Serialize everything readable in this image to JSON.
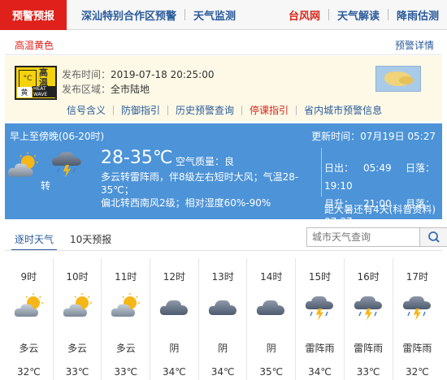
{
  "topnav": {
    "active": "预警预报",
    "items": [
      "深汕特别合作区预警",
      "天气监测"
    ],
    "right": [
      {
        "label": "台风网",
        "color": "red"
      },
      {
        "label": "天气解读",
        "color": "blue"
      },
      {
        "label": "降雨估测",
        "color": "blue"
      }
    ]
  },
  "warning": {
    "title": "高温黄色",
    "detail_link": "预警详情",
    "icon": {
      "name": "high-temperature-yellow-warning-icon",
      "glyph": "高温",
      "level": "黄",
      "sub": "HEAT WAVE",
      "therm": "°C"
    },
    "publish_time_label": "发布时间：",
    "publish_time": "2019-07-18 20:25:00",
    "area_label": "发布区域：",
    "area": "全市陆地",
    "links": [
      {
        "label": "信号含义",
        "color": "blue"
      },
      {
        "label": "防御指引",
        "color": "blue"
      },
      {
        "label": "历史预警查询",
        "color": "blue"
      },
      {
        "label": "停课指引",
        "color": "red"
      },
      {
        "label": "省内城市预警信息",
        "color": "blue"
      }
    ]
  },
  "forecast": {
    "period": "早上至傍晚(06-20时)",
    "update": "更新时间：07月19日 05:27",
    "temp": "28-35℃",
    "air_quality": "空气质量：良",
    "turn": "转",
    "desc_1": "多云转雷阵雨，伴8级左右短时大风；气温28-35℃；",
    "desc_2": "偏北转西南风2级；相对湿度60%-90%",
    "sunrise_label": "日出：",
    "sunrise": "05:49",
    "sunset_label": "日落：",
    "sunset": "19:10",
    "moonrise_label": "月升：",
    "moonrise": "21:00",
    "moonset_label": "月落：",
    "moonset": "07:37",
    "countdown": "距大暑还有4天(科普资料)"
  },
  "tabs": {
    "hourly": "逐时天气",
    "ten_day": "10天预报"
  },
  "search": {
    "placeholder": "城市天气查询"
  },
  "hourly": [
    {
      "time": "9时",
      "weather": "多云",
      "temp": "32℃",
      "icon": "partly-cloudy"
    },
    {
      "time": "10时",
      "weather": "多云",
      "temp": "33℃",
      "icon": "partly-cloudy"
    },
    {
      "time": "11时",
      "weather": "多云",
      "temp": "33℃",
      "icon": "partly-cloudy"
    },
    {
      "time": "12时",
      "weather": "阴",
      "temp": "34℃",
      "icon": "overcast"
    },
    {
      "time": "13时",
      "weather": "阴",
      "temp": "34℃",
      "icon": "overcast"
    },
    {
      "time": "14时",
      "weather": "阴",
      "temp": "35℃",
      "icon": "overcast"
    },
    {
      "time": "15时",
      "weather": "雷阵雨",
      "temp": "34℃",
      "icon": "thunderstorm"
    },
    {
      "time": "16时",
      "weather": "雷阵雨",
      "temp": "33℃",
      "icon": "thunderstorm"
    },
    {
      "time": "17时",
      "weather": "雷阵雨",
      "temp": "32℃",
      "icon": "thunderstorm"
    }
  ],
  "colors": {
    "brand_red": "#e0201a",
    "link_blue": "#2a5b9b",
    "forecast_blue": "#4c93d8",
    "warning_bg": "#fdf9e6"
  }
}
